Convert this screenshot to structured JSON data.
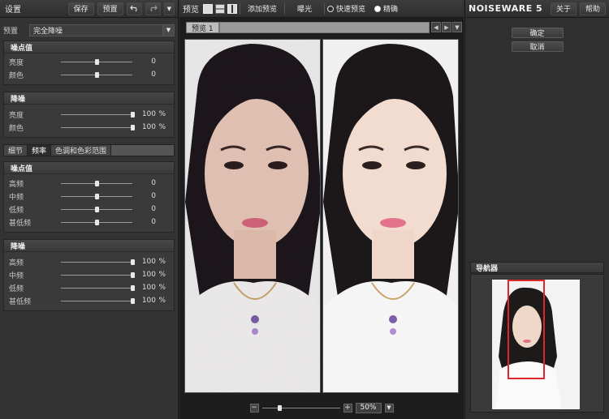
{
  "left": {
    "title": "设置",
    "save": "保存",
    "preset_btn": "预置",
    "undo_icon": "undo-icon",
    "redo_icon": "redo-icon",
    "menu_icon": "chevron-down-icon",
    "preset_label": "预置",
    "preset_value": "完全降噪",
    "g1": {
      "title": "噪点值",
      "rows": [
        {
          "label": "亮度",
          "value": "0",
          "unit": ""
        },
        {
          "label": "颜色",
          "value": "0",
          "unit": ""
        }
      ]
    },
    "g2": {
      "title": "降噪",
      "rows": [
        {
          "label": "亮度",
          "value": "100",
          "unit": "%"
        },
        {
          "label": "颜色",
          "value": "100",
          "unit": "%"
        }
      ]
    },
    "tabs": [
      "细节",
      "频率",
      "色调和色彩范围"
    ],
    "g3": {
      "title": "噪点值",
      "rows": [
        {
          "label": "高频",
          "value": "0",
          "unit": ""
        },
        {
          "label": "中频",
          "value": "0",
          "unit": ""
        },
        {
          "label": "低频",
          "value": "0",
          "unit": ""
        },
        {
          "label": "甚低频",
          "value": "0",
          "unit": ""
        }
      ]
    },
    "g4": {
      "title": "降噪",
      "rows": [
        {
          "label": "高频",
          "value": "100",
          "unit": "%"
        },
        {
          "label": "中频",
          "value": "100",
          "unit": "%"
        },
        {
          "label": "低频",
          "value": "100",
          "unit": "%"
        },
        {
          "label": "甚低频",
          "value": "100",
          "unit": "%"
        }
      ]
    }
  },
  "center": {
    "preview_label": "预览",
    "add_preview": "添加预览",
    "exposure": "曝光",
    "fast_preview": "快速预览",
    "accurate": "精确",
    "tab": "预览 1",
    "zoom": "50%"
  },
  "right": {
    "brand": "NOISEWARE 5",
    "about": "关于",
    "help": "帮助",
    "ok": "确定",
    "cancel": "取消",
    "navigator": "导航器"
  },
  "colors": {
    "accent_red": "#e0262b",
    "panel": "#333333"
  }
}
